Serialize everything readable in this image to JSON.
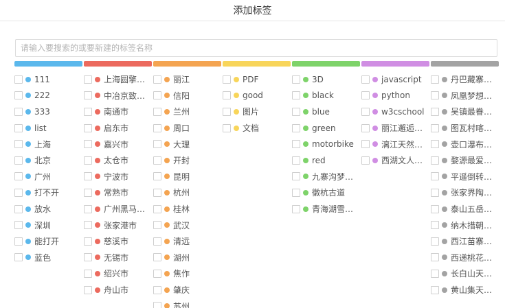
{
  "header": {
    "title": "添加标签"
  },
  "search": {
    "placeholder": "请输入要搜索的或要新建的标签名称",
    "value": ""
  },
  "columns": [
    {
      "color": "#5bb8ec",
      "items": [
        "111",
        "222",
        "333",
        "list",
        "上海",
        "北京",
        "广州",
        "打不开",
        "放水",
        "深圳",
        "能打开",
        "蓝色"
      ]
    },
    {
      "color": "#ec6a5e",
      "items": [
        "上海圆擎信...",
        "中冶京致集...",
        "南通市",
        "启东市",
        "嘉兴市",
        "太仓市",
        "宁波市",
        "常熟市",
        "广州黑马科...",
        "张家港市",
        "慈溪市",
        "无锡市",
        "绍兴市",
        "舟山市"
      ]
    },
    {
      "color": "#f4a451",
      "items": [
        "丽江",
        "信阳",
        "兰州",
        "周口",
        "大理",
        "开封",
        "昆明",
        "杭州",
        "桂林",
        "武汉",
        "清远",
        "湖州",
        "焦作",
        "肇庆",
        "苏州"
      ]
    },
    {
      "color": "#f8d55a",
      "items": [
        "PDF",
        "good",
        "图片",
        "文档"
      ]
    },
    {
      "color": "#7ed36a",
      "items": [
        "3D",
        "black",
        "blue",
        "green",
        "motorbike",
        "red",
        "九寨沟梦幻...",
        "徽杭古道",
        "青海湖雪城..."
      ]
    },
    {
      "color": "#d08ee3",
      "items": [
        "javascript",
        "python",
        "w3cschool",
        "丽江邂逅的...",
        "漓江天然水...",
        "西湖文人骚..."
      ]
    },
    {
      "color": "#a3a3a3",
      "items": [
        "丹巴藏寨与...",
        "凤凰梦想中...",
        "吴镇最眷恋...",
        "图瓦村喀纳...",
        "壶口瀑布母...",
        "婺源最爱村...",
        "平遥倒转时...",
        "张家界陶渊...",
        "泰山五岳之尊",
        "纳木措朝圣...",
        "西江苗寨载...",
        "西递桃花源...",
        "长白山天池...",
        "黄山集天下..."
      ]
    }
  ]
}
